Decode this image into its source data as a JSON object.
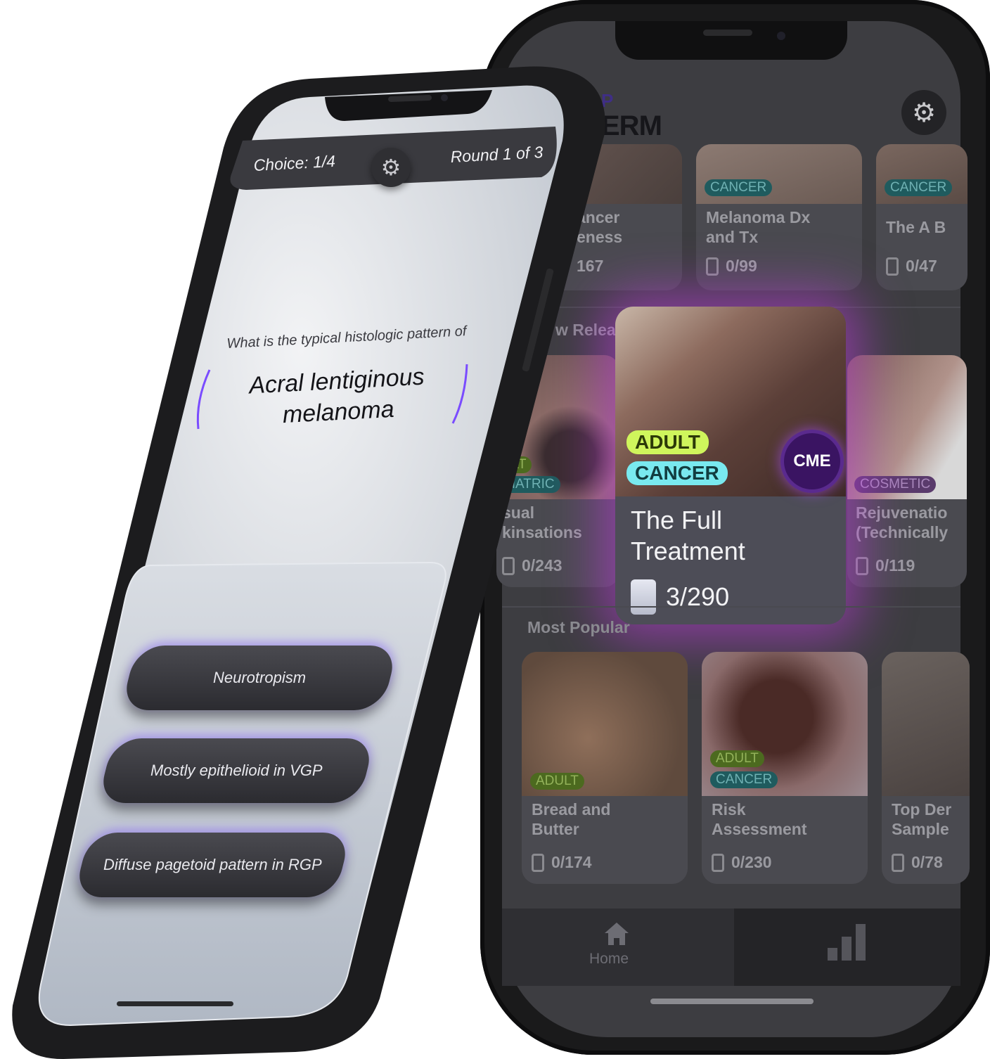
{
  "home": {
    "logo_top": "P",
    "logo_bottom": "ERM",
    "top_row": [
      {
        "title_line1": "ancer",
        "title_line2": "eness",
        "count": "167"
      },
      {
        "tag": "CANCER",
        "title_line1": "Melanoma Dx",
        "title_line2": "and Tx",
        "count": "0/99"
      },
      {
        "tag": "CANCER",
        "title_line1": "The A B",
        "count": "0/47"
      }
    ],
    "new_releases_label": "w Relea",
    "middle_row": [
      {
        "tag1": "ULT",
        "tag2": "DIATRIC",
        "title_line1": "sual",
        "title_line2": "kinsations",
        "count": "0/243"
      },
      {
        "tag": "COSMETIC",
        "title_line1": "Rejuvenatio",
        "title_line2": "(Technically",
        "count": "0/119"
      }
    ],
    "featured": {
      "tag1": "ADULT",
      "tag2": "CANCER",
      "badge": "CME",
      "title_line1": "The Full",
      "title_line2": "Treatment",
      "count": "3/290"
    },
    "most_popular_label": "Most Popular",
    "bottom_row": [
      {
        "tag": "ADULT",
        "title_line1": "Bread and",
        "title_line2": "Butter",
        "count": "0/174"
      },
      {
        "tag1": "ADULT",
        "tag2": "CANCER",
        "title_line1": "Risk",
        "title_line2": "Assessment",
        "count": "0/230"
      },
      {
        "title_line1": "Top Der",
        "title_line2": "Sample",
        "count": "0/78"
      }
    ],
    "nav": {
      "home_label": "Home"
    }
  },
  "quiz": {
    "choice": "Choice: 1/4",
    "round": "Round 1 of 3",
    "prompt": "What is the typical histologic pattern of",
    "term_line1": "Acral lentiginous",
    "term_line2": "melanoma",
    "answers": [
      "Neurotropism",
      "Mostly epithelioid in VGP",
      "Diffuse pagetoid pattern in RGP"
    ]
  },
  "colors": {
    "accent_purple": "#7a4cff",
    "glow": "#c43ce6",
    "adult_tag": "#cff55c",
    "cancer_tag": "#79e9ef"
  }
}
